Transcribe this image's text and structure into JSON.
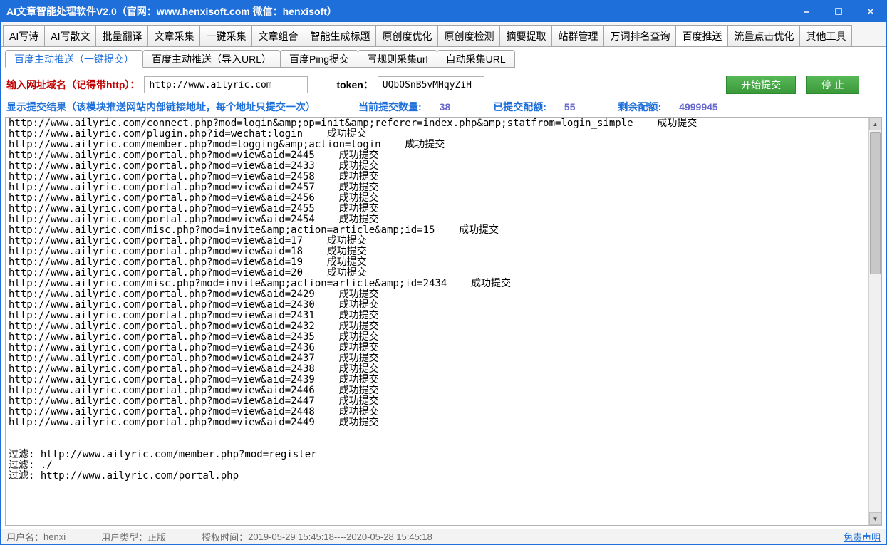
{
  "title": "AI文章智能处理软件V2.0（官网：www.henxisoft.com  微信：henxisoft）",
  "main_tabs": [
    "AI写诗",
    "AI写散文",
    "批量翻译",
    "文章采集",
    "一键采集",
    "文章组合",
    "智能生成标题",
    "原创度优化",
    "原创度检测",
    "摘要提取",
    "站群管理",
    "万词排名查询",
    "百度推送",
    "流量点击优化",
    "其他工具"
  ],
  "main_active_index": 12,
  "sub_tabs": [
    "百度主动推送（一键提交）",
    "百度主动推送（导入URL）",
    "百度Ping提交",
    "写规则采集url",
    "自动采集URL"
  ],
  "sub_active_index": 0,
  "form": {
    "domain_label": "输入网址域名（记得带http）：",
    "domain_value": "http://www.ailyric.com",
    "token_label": "token：",
    "token_value": "UQbOSnB5vMHqyZiH",
    "start_btn": "开始提交",
    "stop_btn": "停  止"
  },
  "stats": {
    "head": "显示提交结果（该模块推送网站内部链接地址，每个地址只提交一次）",
    "cur_label": "当前提交数量:",
    "cur_val": "38",
    "done_label": "已提交配额:",
    "done_val": "55",
    "left_label": "剩余配额:",
    "left_val": "4999945"
  },
  "log": "http://www.ailyric.com/connect.php?mod=login&amp;op=init&amp;referer=index.php&amp;statfrom=login_simple    成功提交\nhttp://www.ailyric.com/plugin.php?id=wechat:login    成功提交\nhttp://www.ailyric.com/member.php?mod=logging&amp;action=login    成功提交\nhttp://www.ailyric.com/portal.php?mod=view&aid=2445    成功提交\nhttp://www.ailyric.com/portal.php?mod=view&aid=2433    成功提交\nhttp://www.ailyric.com/portal.php?mod=view&aid=2458    成功提交\nhttp://www.ailyric.com/portal.php?mod=view&aid=2457    成功提交\nhttp://www.ailyric.com/portal.php?mod=view&aid=2456    成功提交\nhttp://www.ailyric.com/portal.php?mod=view&aid=2455    成功提交\nhttp://www.ailyric.com/portal.php?mod=view&aid=2454    成功提交\nhttp://www.ailyric.com/misc.php?mod=invite&amp;action=article&amp;id=15    成功提交\nhttp://www.ailyric.com/portal.php?mod=view&aid=17    成功提交\nhttp://www.ailyric.com/portal.php?mod=view&aid=18    成功提交\nhttp://www.ailyric.com/portal.php?mod=view&aid=19    成功提交\nhttp://www.ailyric.com/portal.php?mod=view&aid=20    成功提交\nhttp://www.ailyric.com/misc.php?mod=invite&amp;action=article&amp;id=2434    成功提交\nhttp://www.ailyric.com/portal.php?mod=view&aid=2429    成功提交\nhttp://www.ailyric.com/portal.php?mod=view&aid=2430    成功提交\nhttp://www.ailyric.com/portal.php?mod=view&aid=2431    成功提交\nhttp://www.ailyric.com/portal.php?mod=view&aid=2432    成功提交\nhttp://www.ailyric.com/portal.php?mod=view&aid=2435    成功提交\nhttp://www.ailyric.com/portal.php?mod=view&aid=2436    成功提交\nhttp://www.ailyric.com/portal.php?mod=view&aid=2437    成功提交\nhttp://www.ailyric.com/portal.php?mod=view&aid=2438    成功提交\nhttp://www.ailyric.com/portal.php?mod=view&aid=2439    成功提交\nhttp://www.ailyric.com/portal.php?mod=view&aid=2446    成功提交\nhttp://www.ailyric.com/portal.php?mod=view&aid=2447    成功提交\nhttp://www.ailyric.com/portal.php?mod=view&aid=2448    成功提交\nhttp://www.ailyric.com/portal.php?mod=view&aid=2449    成功提交\n\n\n过滤: http://www.ailyric.com/member.php?mod=register\n过滤: ./\n过滤: http://www.ailyric.com/portal.php",
  "status": {
    "user_label": "用户名：",
    "user_val": "henxi",
    "type_label": "用户类型：",
    "type_val": "正版",
    "auth_label": "授权时间：",
    "auth_val": "2019-05-29 15:45:18----2020-05-28 15:45:18",
    "disclaimer": "免责声明"
  }
}
